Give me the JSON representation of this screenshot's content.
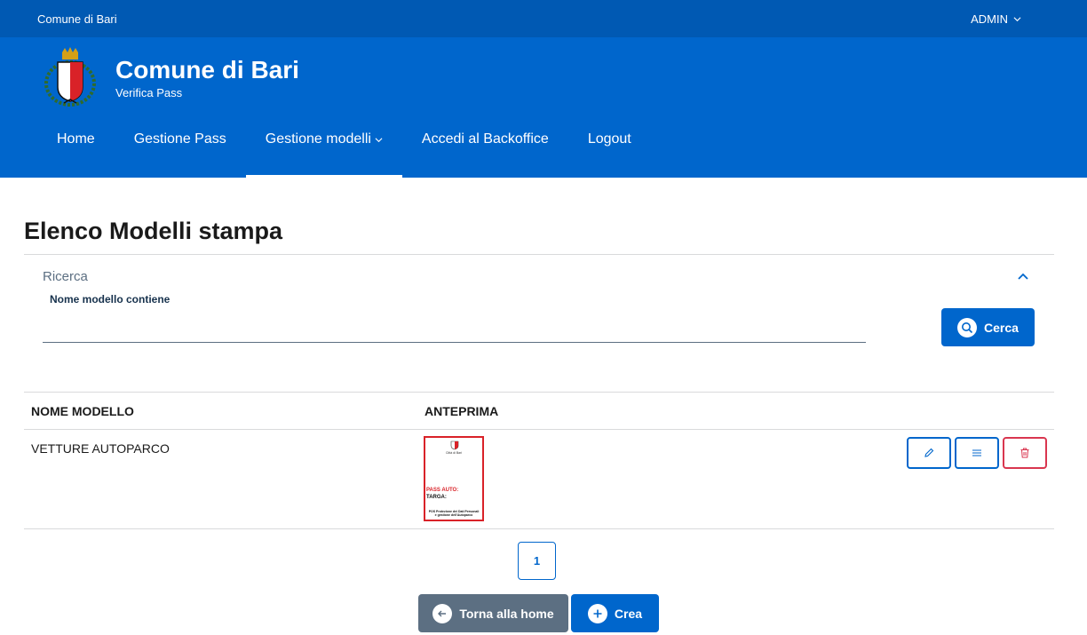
{
  "slim_header": {
    "brand": "Comune di Bari",
    "user": "ADMIN"
  },
  "header": {
    "title": "Comune di Bari",
    "tagline": "Verifica Pass"
  },
  "nav": [
    {
      "label": "Home"
    },
    {
      "label": "Gestione Pass"
    },
    {
      "label": "Gestione modelli",
      "active": true
    },
    {
      "label": "Accedi al Backoffice"
    },
    {
      "label": "Logout"
    }
  ],
  "page": {
    "title": "Elenco Modelli stampa"
  },
  "search": {
    "section_label": "Ricerca",
    "field_label": "Nome modello contiene",
    "field_value": "",
    "button_label": "Cerca"
  },
  "table": {
    "headers": [
      "NOME MODELLO",
      "ANTEPRIMA"
    ],
    "rows": [
      {
        "name": "VETTURE AUTOPARCO",
        "preview": {
          "city": "Città di Bari",
          "pass": "PASS AUTO:",
          "targa": "TARGA:",
          "footer_line1": "POS Protezione dei Dati Personali",
          "footer_line2": "e gestione dell'Autoparco"
        }
      }
    ]
  },
  "pagination": {
    "current": "1"
  },
  "footer_buttons": {
    "back": "Torna alla home",
    "create": "Crea"
  },
  "colors": {
    "primary": "#0066cc",
    "slim": "#0059b3",
    "danger": "#d9364f",
    "secondary": "#5c6f82"
  }
}
